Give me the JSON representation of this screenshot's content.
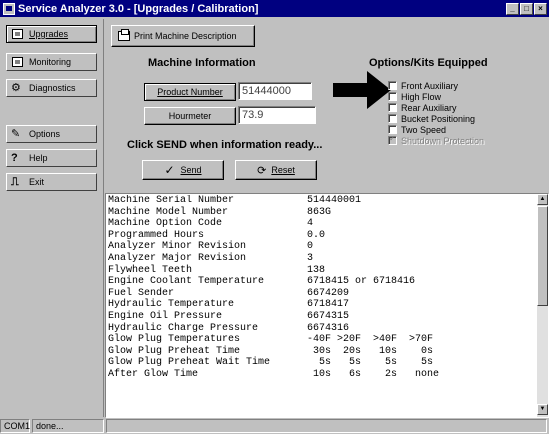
{
  "window": {
    "title": "Service Analyzer 3.0 - [Upgrades / Calibration]",
    "buttons": [
      "_",
      "□",
      "×"
    ]
  },
  "sidebar": {
    "items": [
      {
        "label": "Upgrades",
        "icon": "upgrades-icon",
        "active": true
      },
      {
        "label": "Monitoring",
        "icon": "monitoring-icon",
        "active": false
      },
      {
        "label": "Diagnostics",
        "icon": "diagnostics-icon",
        "active": false
      },
      {
        "label": "Options",
        "icon": "options-icon",
        "active": false
      },
      {
        "label": "Help",
        "icon": "help-icon",
        "active": false
      },
      {
        "label": "Exit",
        "icon": "exit-icon",
        "active": false
      }
    ]
  },
  "toolbar": {
    "print_label": "Print Machine Description"
  },
  "machine_info": {
    "heading": "Machine Information",
    "product_number_label": "Product Number",
    "product_number_value": "51444000",
    "hourmeter_label": "Hourmeter",
    "hourmeter_value": "73.9",
    "send_prompt": "Click SEND when information ready...",
    "send_label": "Send",
    "reset_label": "Reset"
  },
  "options_kits": {
    "heading": "Options/Kits Equipped",
    "items": [
      {
        "label": "Front Auxiliary",
        "checked": false,
        "disabled": false
      },
      {
        "label": "High Flow",
        "checked": false,
        "disabled": false
      },
      {
        "label": "Rear Auxiliary",
        "checked": false,
        "disabled": false
      },
      {
        "label": "Bucket Positioning",
        "checked": false,
        "disabled": false
      },
      {
        "label": "Two Speed",
        "checked": false,
        "disabled": false
      },
      {
        "label": "Shutdown Protection",
        "checked": true,
        "disabled": true
      }
    ]
  },
  "report": {
    "rows": [
      {
        "key": "Machine Serial Number",
        "value": "514440001"
      },
      {
        "key": "Machine Model Number",
        "value": "863G"
      },
      {
        "key": "Machine Option Code",
        "value": "4"
      },
      {
        "key": "Programmed Hours",
        "value": "0.0"
      },
      {
        "key": "Analyzer Minor Revision",
        "value": "0"
      },
      {
        "key": "Analyzer Major Revision",
        "value": "3"
      },
      {
        "key": "Flywheel Teeth",
        "value": "138"
      },
      {
        "key": "Engine Coolant Temperature",
        "value": "6718415 or 6718416"
      },
      {
        "key": "Fuel Sender",
        "value": "6674209"
      },
      {
        "key": "Hydraulic Temperature",
        "value": "6718417"
      },
      {
        "key": "Engine Oil Pressure",
        "value": "6674315"
      },
      {
        "key": "Hydraulic Charge Pressure",
        "value": "6674316"
      },
      {
        "key": "Glow Plug Temperatures",
        "value": "-40F >20F  >40F  >70F"
      },
      {
        "key": "Glow Plug Preheat Time",
        "value": " 30s  20s   10s    0s"
      },
      {
        "key": "Glow Plug Preheat Wait Time",
        "value": "  5s   5s    5s    5s"
      },
      {
        "key": "After Glow Time",
        "value": " 10s   6s    2s   none"
      }
    ]
  },
  "status": {
    "port": "COM1",
    "state": "done..."
  }
}
